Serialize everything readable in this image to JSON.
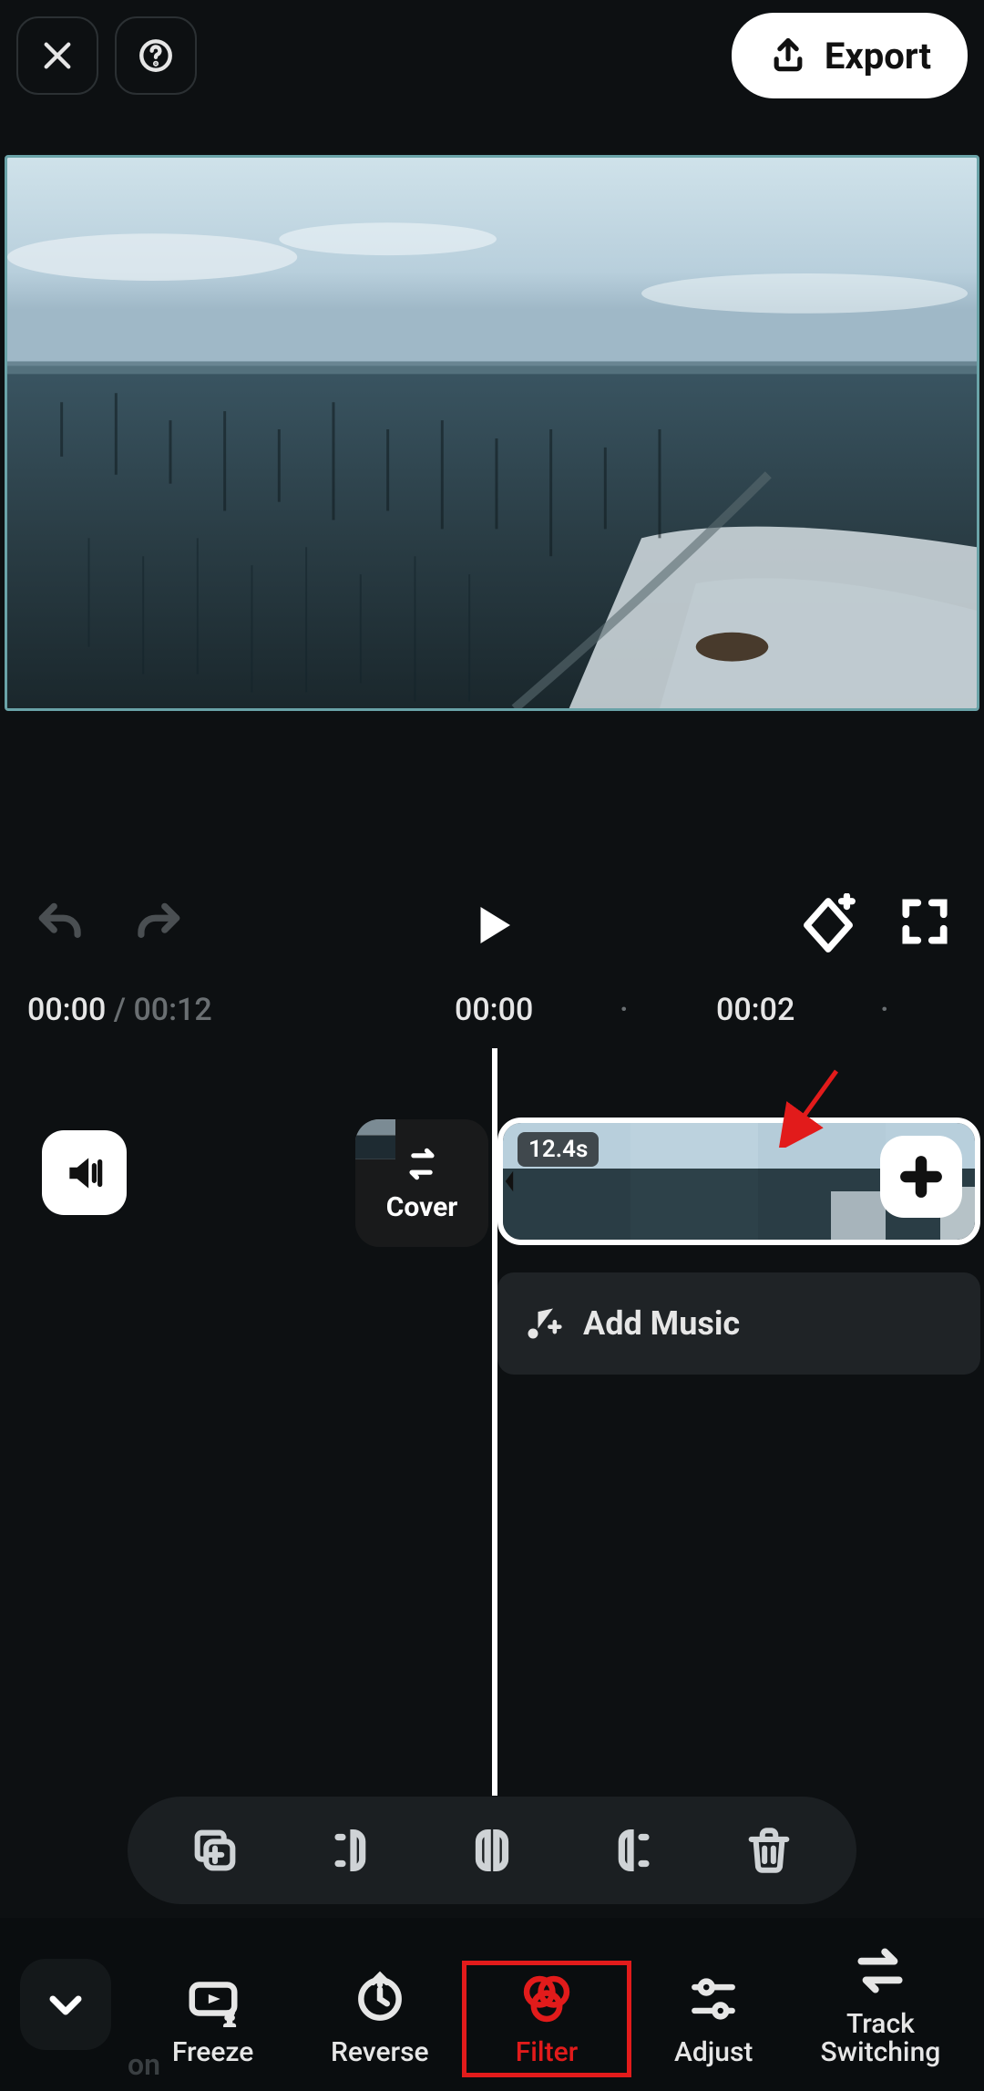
{
  "header": {
    "export_label": "Export"
  },
  "icons": {
    "close": "close-icon",
    "help": "help-icon",
    "export": "export-icon",
    "undo": "undo-icon",
    "redo": "redo-icon",
    "play": "play-icon",
    "keyframe": "keyframe-add-icon",
    "fullscreen": "fullscreen-icon",
    "mute": "volume-icon",
    "swap": "swap-icon",
    "add": "plus-icon",
    "music": "music-add-icon",
    "collapse": "chevron-down-icon",
    "copy": "duplicate-icon",
    "split_left": "trim-left-icon",
    "split": "split-icon",
    "split_right": "trim-right-icon",
    "delete": "trash-icon"
  },
  "time": {
    "current": "00:00",
    "separator": "/",
    "duration": "00:12",
    "ticks": [
      {
        "pos": 540,
        "label": "00:00"
      },
      {
        "pos": 826,
        "label": "00:02"
      }
    ],
    "dots": [
      {
        "pos": 684
      },
      {
        "pos": 970
      }
    ]
  },
  "timeline": {
    "cover_label": "Cover",
    "clip_duration_badge": "12.4s",
    "add_music_label": "Add Music"
  },
  "bottom": {
    "ghost": "on",
    "tools": [
      {
        "key": "freeze",
        "label": "Freeze",
        "icon": "freeze-icon"
      },
      {
        "key": "reverse",
        "label": "Reverse",
        "icon": "reverse-icon"
      },
      {
        "key": "filter",
        "label": "Filter",
        "icon": "filter-icon",
        "highlight": true
      },
      {
        "key": "adjust",
        "label": "Adjust",
        "icon": "adjust-icon"
      },
      {
        "key": "track",
        "label": "Track\nSwitching",
        "icon": "track-switching-icon"
      }
    ]
  }
}
